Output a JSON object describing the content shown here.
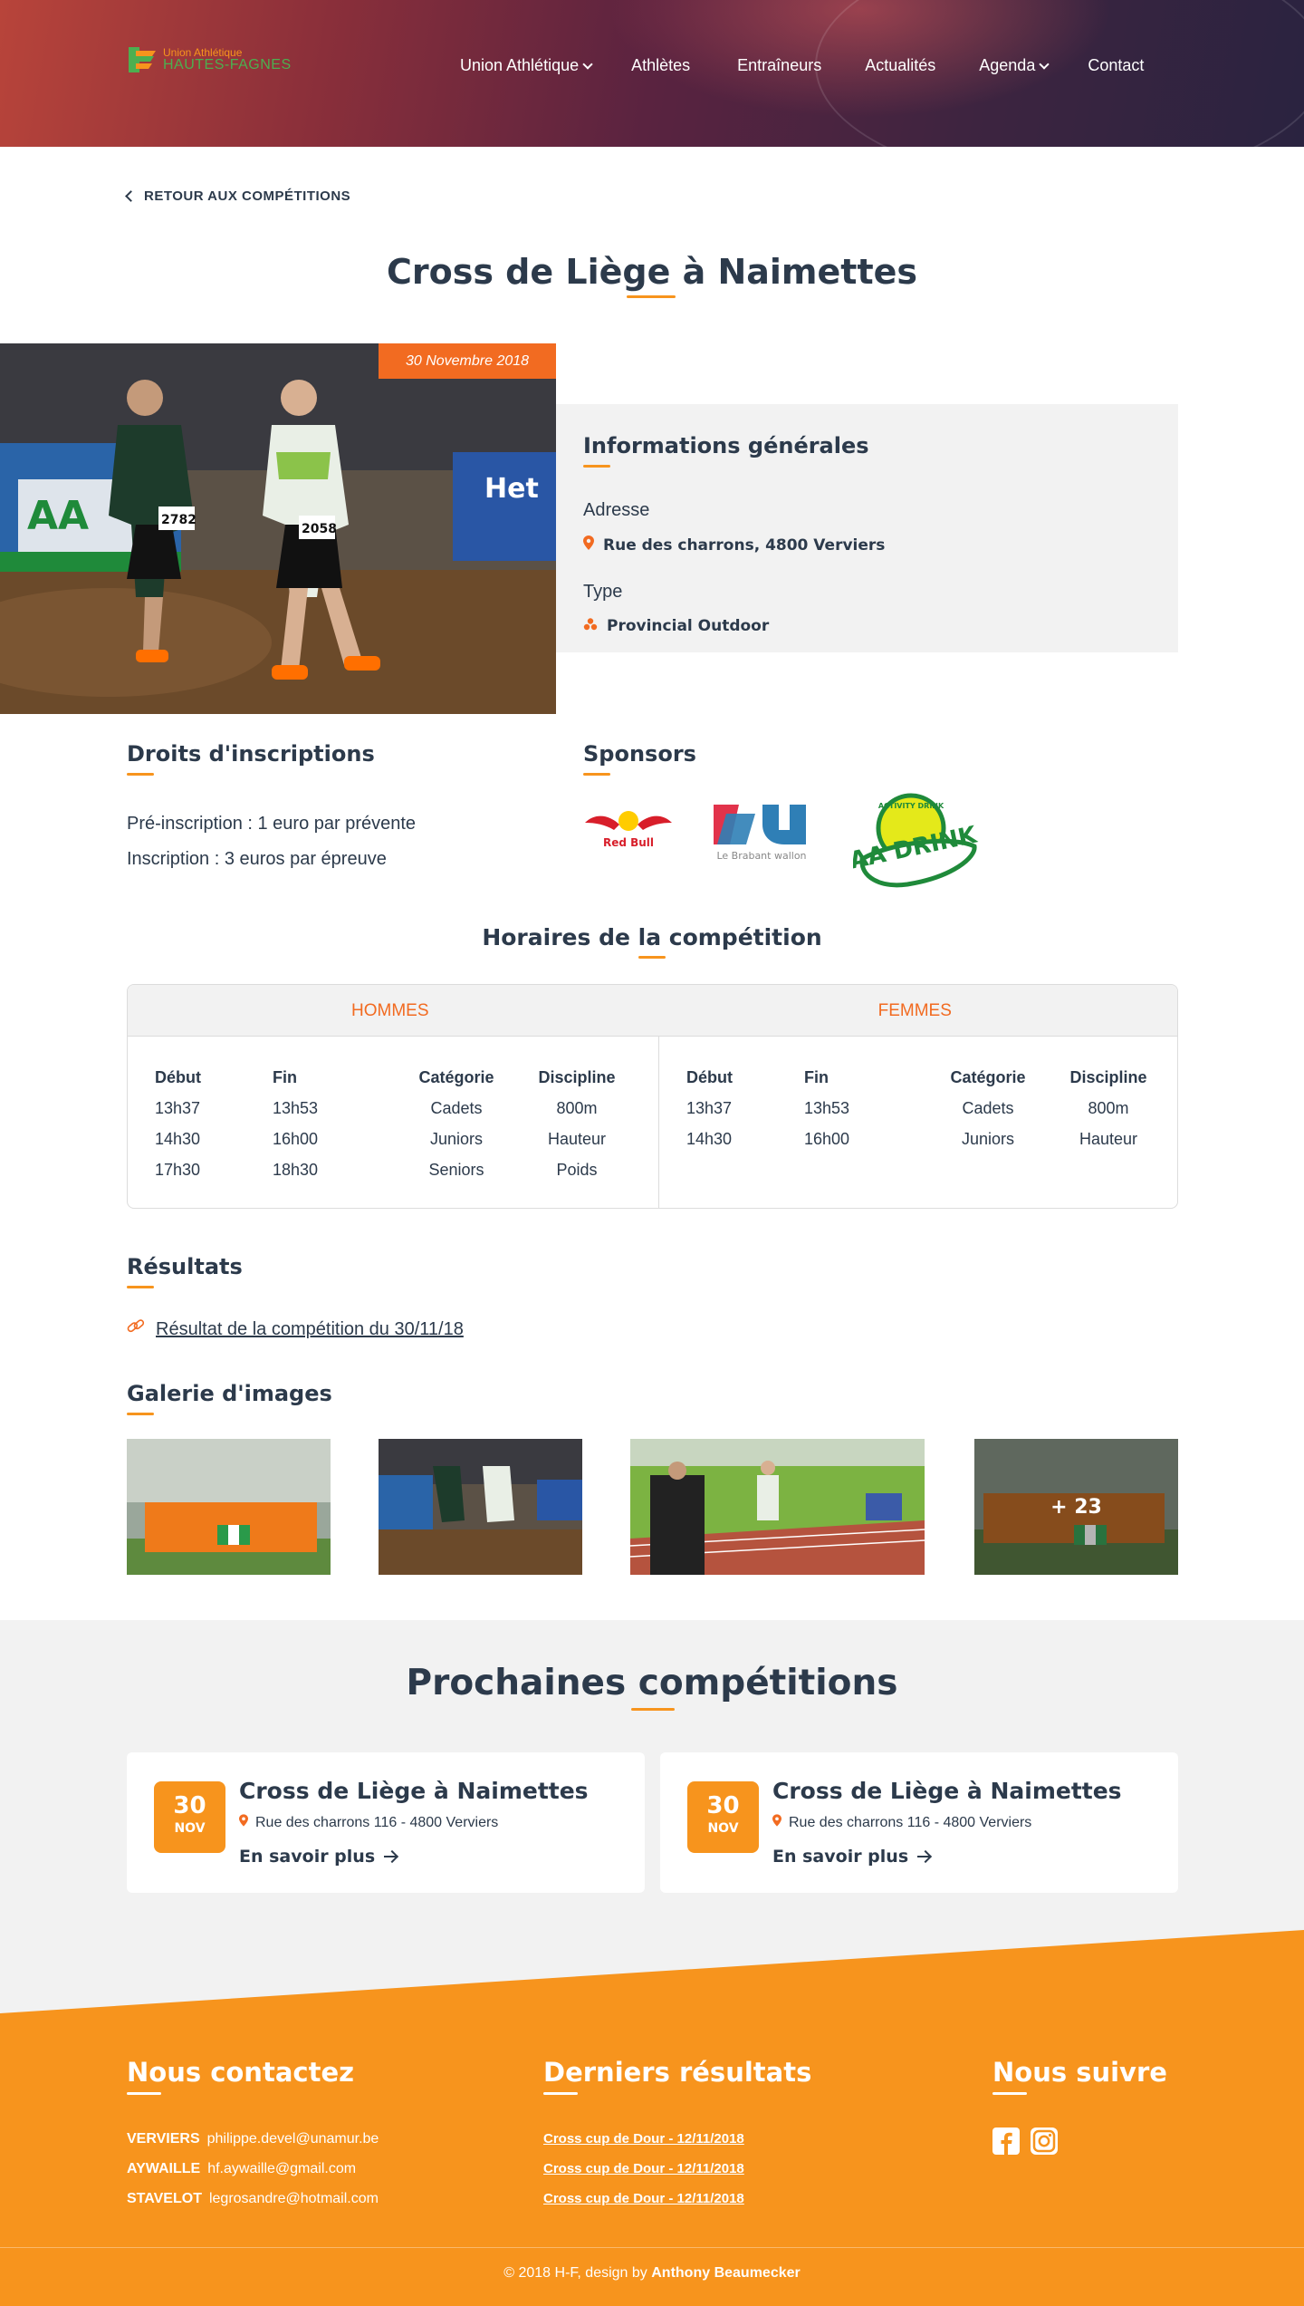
{
  "header": {
    "logo_line1": "Union Athlétique",
    "logo_line2": "HAUTES-FAGNES",
    "nav": [
      {
        "label": "Union Athlétique",
        "dropdown": true
      },
      {
        "label": "Athlètes",
        "dropdown": false
      },
      {
        "label": "Entraîneurs",
        "dropdown": false
      },
      {
        "label": "Actualités",
        "dropdown": false
      },
      {
        "label": "Agenda",
        "dropdown": true
      },
      {
        "label": "Contact",
        "dropdown": false
      }
    ]
  },
  "back_label": "RETOUR AUX COMPÉTITIONS",
  "title": "Cross de Liège à Naimettes",
  "date_tag": "30 Novembre 2018",
  "info": {
    "heading": "Informations générales",
    "address_label": "Adresse",
    "address_value": "Rue des charrons, 4800 Verviers",
    "type_label": "Type",
    "type_value": "Provincial Outdoor"
  },
  "fees": {
    "heading": "Droits d'inscriptions",
    "items": [
      "Pré-inscription : 1 euro par prévente",
      "Inscription : 3 euros par épreuve"
    ]
  },
  "sponsors": {
    "heading": "Sponsors",
    "items": [
      {
        "name": "Red Bull"
      },
      {
        "name": "Le Brabant wallon"
      },
      {
        "name": "AA DRINK",
        "ring_text": "ACTIVITY DRINK"
      }
    ]
  },
  "schedule": {
    "heading": "Horaires de la compétition",
    "columns": [
      "Début",
      "Fin",
      "Catégorie",
      "Discipline"
    ],
    "men": {
      "label": "HOMMES",
      "rows": [
        [
          "13h37",
          "13h53",
          "Cadets",
          "800m"
        ],
        [
          "14h30",
          "16h00",
          "Juniors",
          "Hauteur"
        ],
        [
          "17h30",
          "18h30",
          "Seniors",
          "Poids"
        ]
      ]
    },
    "women": {
      "label": "FEMMES",
      "rows": [
        [
          "13h37",
          "13h53",
          "Cadets",
          "800m"
        ],
        [
          "14h30",
          "16h00",
          "Juniors",
          "Hauteur"
        ]
      ]
    }
  },
  "results": {
    "heading": "Résultats",
    "link": "Résultat de la compétition du 30/11/18"
  },
  "gallery": {
    "heading": "Galerie d'images",
    "more_label": "+ 23"
  },
  "upcoming": {
    "heading": "Prochaines compétitions",
    "cards": [
      {
        "day": "30",
        "month": "NOV",
        "title": "Cross de Liège à Naimettes",
        "address": "Rue des charrons 116 - 4800 Verviers",
        "more": "En savoir plus"
      },
      {
        "day": "30",
        "month": "NOV",
        "title": "Cross de Liège à Naimettes",
        "address": "Rue des charrons 116 - 4800 Verviers",
        "more": "En savoir plus"
      }
    ]
  },
  "footer": {
    "contact_heading": "Nous contactez",
    "contacts": [
      {
        "city": "VERVIERS",
        "email": "philippe.devel@unamur.be"
      },
      {
        "city": "AYWAILLE",
        "email": "hf.aywaille@gmail.com"
      },
      {
        "city": "STAVELOT",
        "email": "legrosandre@hotmail.com"
      }
    ],
    "results_heading": "Derniers résultats",
    "results": [
      "Cross cup de Dour - 12/11/2018",
      "Cross cup de Dour - 12/11/2018",
      "Cross cup de Dour - 12/11/2018"
    ],
    "follow_heading": "Nous suivre",
    "social": [
      "facebook-icon",
      "instagram-icon"
    ],
    "copyright_prefix": "© 2018 H-F, design by",
    "designer": "Anthony Beaumecker"
  },
  "colors": {
    "accent": "#f7941d",
    "accent_dark": "#f26b21",
    "text": "#2c3a4b",
    "panel": "#f2f2f2"
  }
}
